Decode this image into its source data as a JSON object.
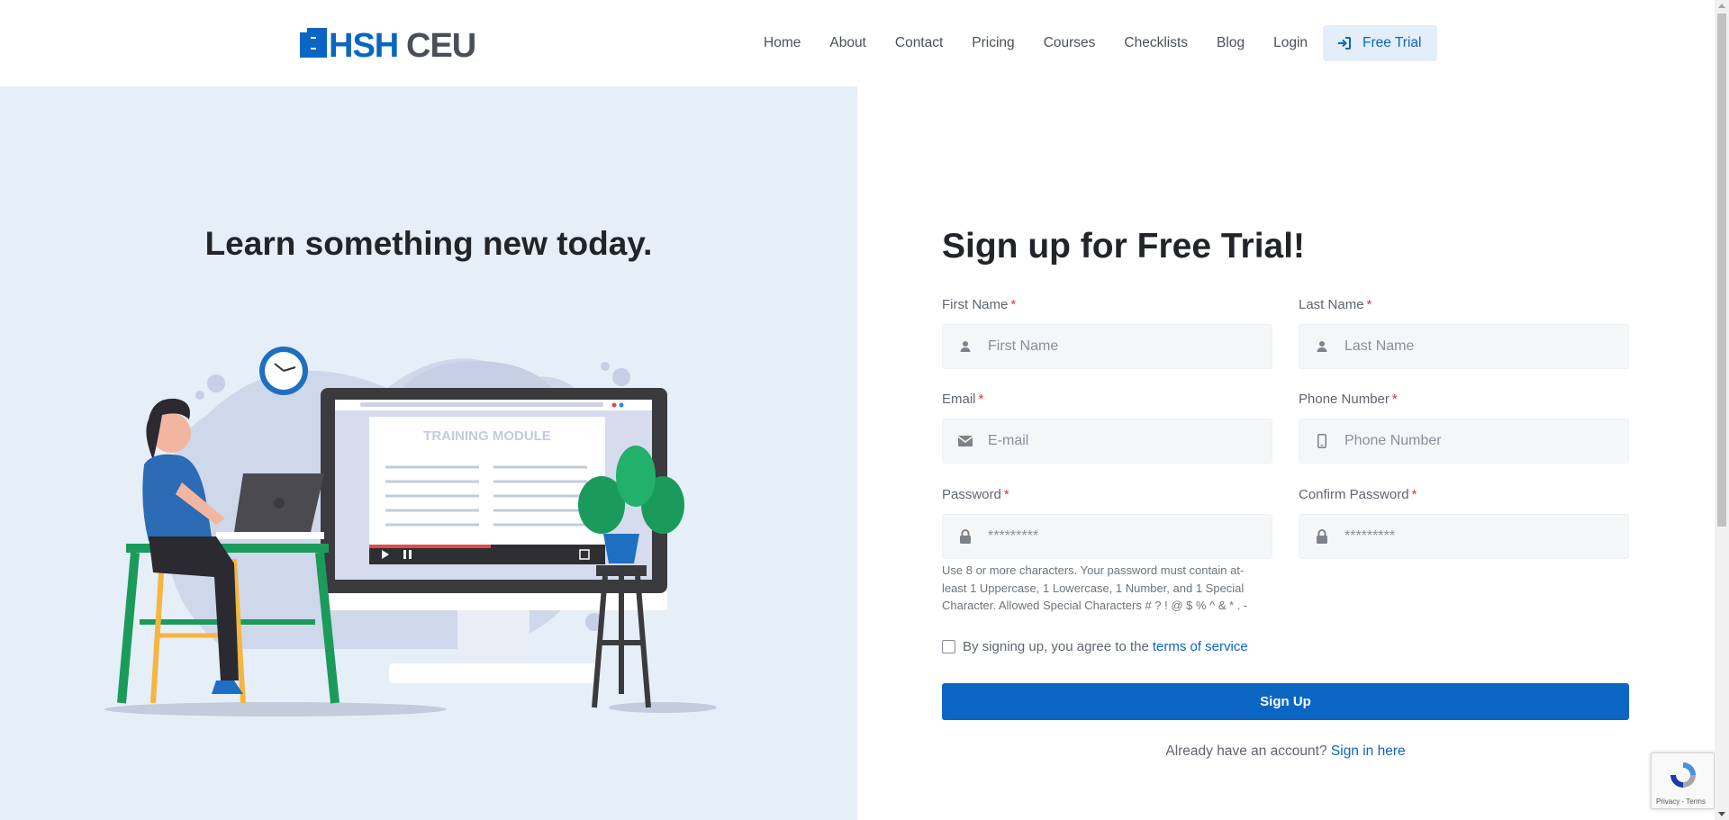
{
  "brand": {
    "logo_text": "HSHCEU",
    "logo_part1": "HSH",
    "logo_part2": "CEU",
    "primary_color": "#0a66c2"
  },
  "nav": {
    "items": [
      "Home",
      "About",
      "Contact",
      "Pricing",
      "Courses",
      "Checklists",
      "Blog",
      "Login"
    ],
    "cta_label": "Free Trial"
  },
  "hero": {
    "headline": "Learn something new today.",
    "illustration_caption": "TRAINING MODULE"
  },
  "form": {
    "title": "Sign up for Free Trial!",
    "required_marker": "*",
    "first_name": {
      "label": "First Name",
      "placeholder": "First Name",
      "icon": "user-icon"
    },
    "last_name": {
      "label": "Last Name",
      "placeholder": "Last Name",
      "icon": "user-icon"
    },
    "email": {
      "label": "Email",
      "placeholder": "E-mail",
      "icon": "envelope-icon"
    },
    "phone": {
      "label": "Phone Number",
      "placeholder": "Phone Number",
      "icon": "phone-icon"
    },
    "password": {
      "label": "Password",
      "placeholder": "*********",
      "icon": "lock-icon"
    },
    "confirm_password": {
      "label": "Confirm Password",
      "placeholder": "*********",
      "icon": "lock-icon"
    },
    "password_hint": "Use 8 or more characters. Your password must contain at-least 1 Uppercase, 1 Lowercase, 1 Number, and 1 Special Character. Allowed Special Characters # ? ! @ $ % ^ & * . -",
    "agree_text": "By signing up, you agree to the",
    "terms_link": "terms of service",
    "submit_label": "Sign Up",
    "already_text": "Already have an account?",
    "signin_link": "Sign in here"
  },
  "recaptcha": {
    "text": "Privacy - Terms"
  }
}
